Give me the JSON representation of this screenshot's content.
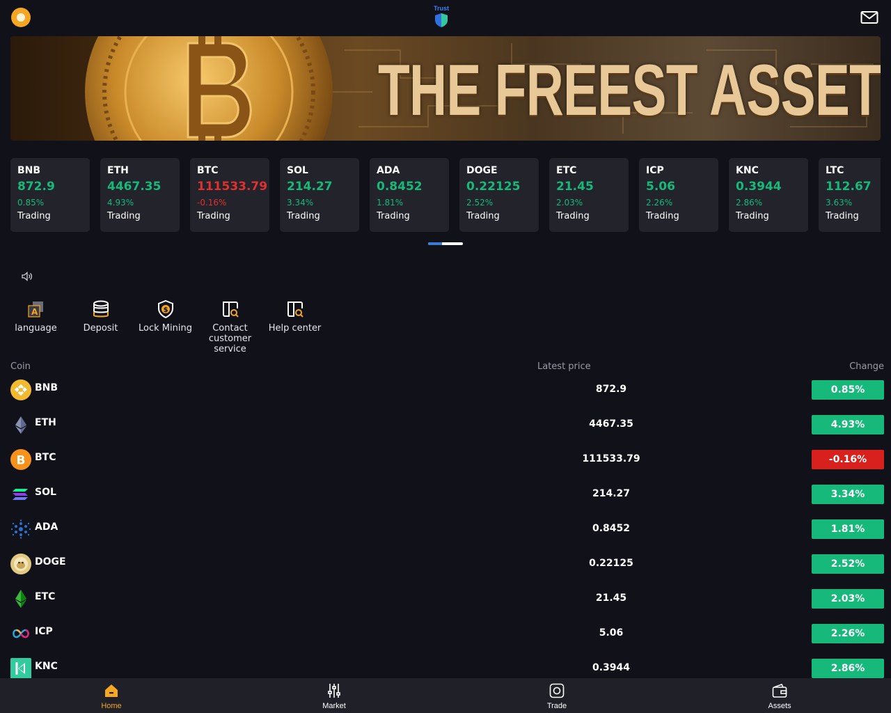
{
  "header": {
    "logo_text": "Trust"
  },
  "banner": {
    "headline": "THE FREEST ASSET"
  },
  "tickers": [
    {
      "symbol": "BNB",
      "price": "872.9",
      "change": "0.85%",
      "status": "Trading",
      "trend": "up"
    },
    {
      "symbol": "ETH",
      "price": "4467.35",
      "change": "4.93%",
      "status": "Trading",
      "trend": "up"
    },
    {
      "symbol": "BTC",
      "price": "111533.79",
      "change": "-0.16%",
      "status": "Trading",
      "trend": "down"
    },
    {
      "symbol": "SOL",
      "price": "214.27",
      "change": "3.34%",
      "status": "Trading",
      "trend": "up"
    },
    {
      "symbol": "ADA",
      "price": "0.8452",
      "change": "1.81%",
      "status": "Trading",
      "trend": "up"
    },
    {
      "symbol": "DOGE",
      "price": "0.22125",
      "change": "2.52%",
      "status": "Trading",
      "trend": "up"
    },
    {
      "symbol": "ETC",
      "price": "21.45",
      "change": "2.03%",
      "status": "Trading",
      "trend": "up"
    },
    {
      "symbol": "ICP",
      "price": "5.06",
      "change": "2.26%",
      "status": "Trading",
      "trend": "up"
    },
    {
      "symbol": "KNC",
      "price": "0.3944",
      "change": "2.86%",
      "status": "Trading",
      "trend": "up"
    },
    {
      "symbol": "LTC",
      "price": "112.67",
      "change": "3.63%",
      "status": "Trading",
      "trend": "up"
    }
  ],
  "quick_actions": [
    {
      "label": "language",
      "icon": "language-icon"
    },
    {
      "label": "Deposit",
      "icon": "coin-stack-icon"
    },
    {
      "label": "Lock Mining",
      "icon": "shield-dollar-icon"
    },
    {
      "label": "Contact customer service",
      "icon": "support-search-icon"
    },
    {
      "label": "Help center",
      "icon": "help-search-icon"
    }
  ],
  "market": {
    "headers": {
      "coin": "Coin",
      "price": "Latest price",
      "change": "Change"
    },
    "rows": [
      {
        "coin": "BNB",
        "price": "872.9",
        "change": "0.85%",
        "trend": "up",
        "icon": "bnb-icon"
      },
      {
        "coin": "ETH",
        "price": "4467.35",
        "change": "4.93%",
        "trend": "up",
        "icon": "eth-icon"
      },
      {
        "coin": "BTC",
        "price": "111533.79",
        "change": "-0.16%",
        "trend": "down",
        "icon": "btc-icon"
      },
      {
        "coin": "SOL",
        "price": "214.27",
        "change": "3.34%",
        "trend": "up",
        "icon": "sol-icon"
      },
      {
        "coin": "ADA",
        "price": "0.8452",
        "change": "1.81%",
        "trend": "up",
        "icon": "ada-icon"
      },
      {
        "coin": "DOGE",
        "price": "0.22125",
        "change": "2.52%",
        "trend": "up",
        "icon": "doge-icon"
      },
      {
        "coin": "ETC",
        "price": "21.45",
        "change": "2.03%",
        "trend": "up",
        "icon": "etc-icon"
      },
      {
        "coin": "ICP",
        "price": "5.06",
        "change": "2.26%",
        "trend": "up",
        "icon": "icp-icon"
      },
      {
        "coin": "KNC",
        "price": "0.3944",
        "change": "2.86%",
        "trend": "up",
        "icon": "knc-icon"
      }
    ]
  },
  "bottom_nav": [
    {
      "label": "Home",
      "icon": "home-icon",
      "active": true
    },
    {
      "label": "Market",
      "icon": "sliders-icon",
      "active": false
    },
    {
      "label": "Trade",
      "icon": "trade-icon",
      "active": false
    },
    {
      "label": "Assets",
      "icon": "wallet-icon",
      "active": false
    }
  ],
  "colors": {
    "background": "#11111a",
    "card": "#22232b",
    "up": "#16b979",
    "down": "#d8201c",
    "accent": "#f5a623",
    "nav_bg": "#1f2028"
  }
}
